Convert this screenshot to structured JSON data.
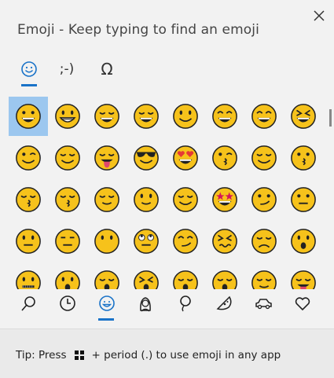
{
  "window": {
    "title": "Emoji - Keep typing to find an emoji",
    "close_icon": "close-icon"
  },
  "tabs": [
    {
      "id": "emoji",
      "label": "☺",
      "active": true
    },
    {
      "id": "kaomoji",
      "label": ";-)",
      "active": false
    },
    {
      "id": "symbols",
      "label": "Ω",
      "active": false
    }
  ],
  "emoji_rows": [
    [
      "grin",
      "grimace",
      "joy",
      "rofl",
      "smile",
      "smile-open",
      "sweat-smile",
      "squint"
    ],
    [
      "wink",
      "blush",
      "yum",
      "sunglasses",
      "heart-eyes",
      "kiss-heart",
      "hearts",
      "kiss"
    ],
    [
      "kiss-smile",
      "kiss-closed",
      "relaxed",
      "slight-smile",
      "hug",
      "star-struck",
      "thinking",
      "raised-brow"
    ],
    [
      "neutral",
      "expressionless",
      "no-mouth",
      "eye-roll",
      "smirk",
      "persevere",
      "disappointed-relieved",
      "open-mouth"
    ],
    [
      "zipper",
      "hushed",
      "sleepy",
      "tired",
      "yawn",
      "sleeping",
      "relieved",
      "tongue"
    ]
  ],
  "selected_emoji": "grin",
  "categories": [
    {
      "id": "search",
      "icon": "search-icon",
      "active": false
    },
    {
      "id": "recent",
      "icon": "clock-icon",
      "active": false
    },
    {
      "id": "smileys",
      "icon": "smiley-icon",
      "active": true
    },
    {
      "id": "people",
      "icon": "person-icon",
      "active": false
    },
    {
      "id": "celebration",
      "icon": "balloon-icon",
      "active": false
    },
    {
      "id": "food",
      "icon": "pizza-icon",
      "active": false
    },
    {
      "id": "transport",
      "icon": "car-icon",
      "active": false
    },
    {
      "id": "symbols",
      "icon": "heart-icon",
      "active": false
    }
  ],
  "footer": {
    "tip_prefix": "Tip: Press",
    "tip_suffix": "+ period (.) to use emoji in any app"
  },
  "colors": {
    "accent": "#1a73c8",
    "selection": "#9cc7ef",
    "emoji_yellow": "#f6c21b",
    "emoji_outline": "#222222"
  }
}
